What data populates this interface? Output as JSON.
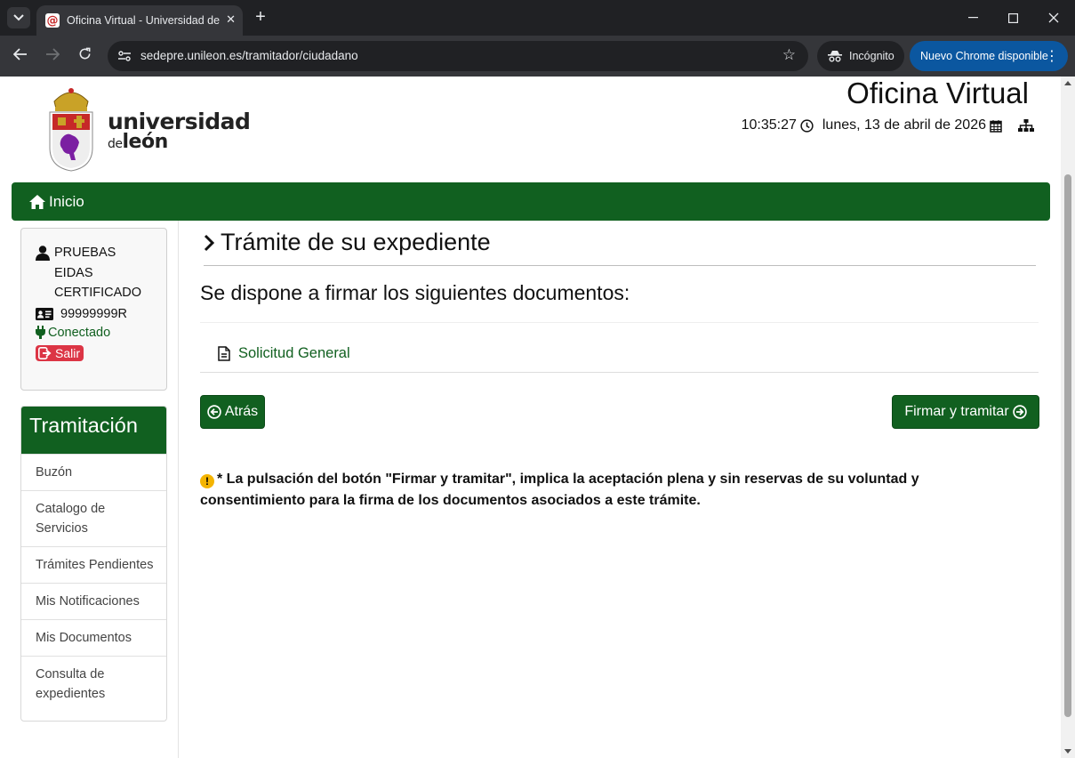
{
  "browser": {
    "tab_title": "Oficina Virtual - Universidad de León",
    "url": "sedepre.unileon.es/tramitador/ciudadano",
    "incognito_label": "Incógnito",
    "update_label": "Nuevo Chrome disponible"
  },
  "header": {
    "logo_line1": "universidad",
    "logo_de": "de",
    "logo_line2": "león",
    "site_title": "Oficina Virtual",
    "time": "10:35:27",
    "date": "lunes, 13 de abril de 2026"
  },
  "nav": {
    "home_label": "Inicio"
  },
  "user": {
    "name": "PRUEBAS EIDAS  CERTIFICADO",
    "id": "99999999R",
    "status": "Conectado",
    "logout_label": "Salir"
  },
  "sidebar": {
    "title": "Tramitación",
    "items": [
      {
        "label": "Buzón"
      },
      {
        "label": "Catalogo de Servicios"
      },
      {
        "label": "Trámites Pendientes"
      },
      {
        "label": "Mis Notificaciones"
      },
      {
        "label": "Mis Documentos"
      },
      {
        "label": "Consulta de expedientes"
      }
    ]
  },
  "main": {
    "heading": "Trámite de su expediente",
    "intro": "Se dispone a firmar los siguientes documentos:",
    "documents": [
      {
        "name": "Solicitud General"
      }
    ],
    "back_label": "Atrás",
    "sign_label": "Firmar y tramitar",
    "note": "* La pulsación del botón \"Firmar y tramitar\", implica la aceptación plena y sin reservas de su voluntad y consentimiento para la firma de los documentos asociados a este trámite."
  },
  "colors": {
    "brand_green": "#116020",
    "danger": "#dc3545",
    "chrome_update_blue": "#0b57a0"
  }
}
